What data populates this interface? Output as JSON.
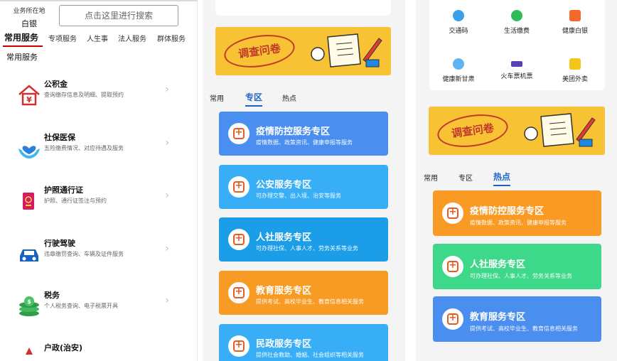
{
  "panel1": {
    "location_label": "业务所在地",
    "location_value": "白银",
    "search_placeholder": "点击这里进行搜索",
    "tabs": [
      "常用服务",
      "专项服务",
      "人生事",
      "法人服务",
      "群体服务"
    ],
    "section_title": "常用服务",
    "items": [
      {
        "title": "公积金",
        "desc": "查询缴存信息及明细、提取预约",
        "icon": "house-yen-icon"
      },
      {
        "title": "社保医保",
        "desc": "五险缴费情况、对应待遇及服务",
        "icon": "hands-heart-icon"
      },
      {
        "title": "护照通行证",
        "desc": "护照、通行证签注与预约",
        "icon": "passport-icon"
      },
      {
        "title": "行驶驾驶",
        "desc": "违章缴罚查询、车辆及证件服务",
        "icon": "car-icon"
      },
      {
        "title": "税务",
        "desc": "个人税务查询、电子税票开具",
        "icon": "coins-icon"
      },
      {
        "title": "户政(治安)",
        "desc": "",
        "icon": "police-icon"
      }
    ],
    "arrow": "›"
  },
  "panel2": {
    "banner_text": "调查问卷",
    "tabs": [
      "常用",
      "专区",
      "热点"
    ],
    "cards": [
      {
        "title": "疫情防控服务专区",
        "desc": "疫情数据、政策资讯、健康申报等服务",
        "color": "#4a8ef0"
      },
      {
        "title": "公安服务专区",
        "desc": "可办理交警、出入境、治安等服务",
        "color": "#37aef5"
      },
      {
        "title": "人社服务专区",
        "desc": "可办理社保、人事人才、劳务关系等业务",
        "color": "#1b9de8"
      },
      {
        "title": "教育服务专区",
        "desc": "提供考试、高校毕业生、教育信息相关服务",
        "color": "#f79b24"
      },
      {
        "title": "民政服务专区",
        "desc": "提供社会救助、婚姻、社会组织等相关服务",
        "color": "#37aef5"
      }
    ]
  },
  "panel3": {
    "services": [
      {
        "label": "交通码",
        "color": "#3aa0e8",
        "icon": "traffic-code-icon"
      },
      {
        "label": "生活缴费",
        "color": "#2ebd5a",
        "icon": "utility-payment-icon"
      },
      {
        "label": "健康白银",
        "color": "#f26b2a",
        "icon": "health-icon"
      },
      {
        "label": "健康新甘肃",
        "color": "#5fb3ef",
        "icon": "health-gansu-icon"
      },
      {
        "label": "火车票机票",
        "color": "#5a3fb5",
        "icon": "train-plane-icon"
      },
      {
        "label": "美团外卖",
        "color": "#f5c518",
        "icon": "meituan-icon"
      }
    ],
    "banner_text": "调查问卷",
    "tabs": [
      "常用",
      "专区",
      "热点"
    ],
    "cards": [
      {
        "title": "疫情防控服务专区",
        "desc": "疫情数据、政策资讯、健康申报等服务",
        "color": "#f99a24"
      },
      {
        "title": "人社服务专区",
        "desc": "可办理社保、人事人才、劳务关系等业务",
        "color": "#3ed88a"
      },
      {
        "title": "教育服务专区",
        "desc": "提供考试、高校毕业生、教育信息相关服务",
        "color": "#4a8ef0"
      }
    ]
  }
}
